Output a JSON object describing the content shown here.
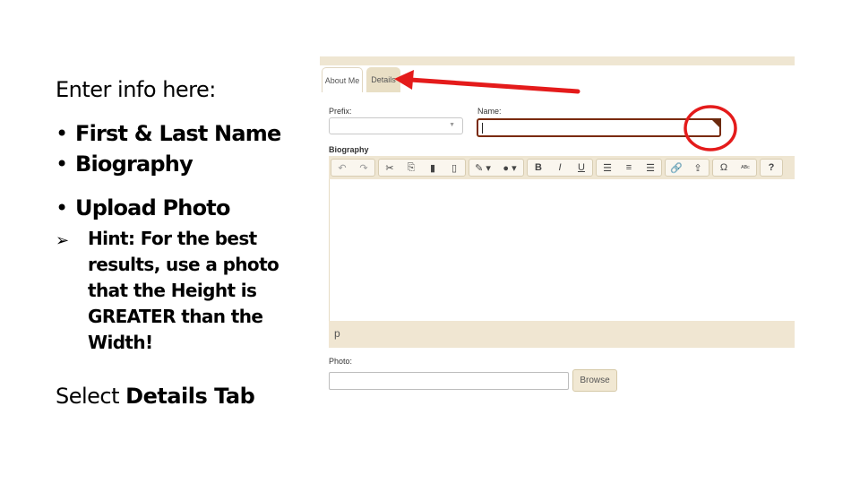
{
  "instructions": {
    "intro": "Enter info here:",
    "bullets": [
      "First & Last Name",
      "Biography"
    ],
    "upload": "Upload Photo",
    "hint": "Hint: For the best results, use a photo that the Height is GREATER than the Width!",
    "select_prefix": "Select ",
    "select_bold": "Details Tab",
    "bullet_glyph": "•",
    "hint_glyph": "➢"
  },
  "form": {
    "tabs": [
      {
        "label": "About Me",
        "active": true
      },
      {
        "label": "Details",
        "active": false
      }
    ],
    "prefix": {
      "label": "Prefix:",
      "value": ""
    },
    "name": {
      "label": "Name:",
      "value": ""
    },
    "biography": {
      "label": "Biography",
      "status_path": "p"
    },
    "toolbar": [
      [
        "undo-icon",
        "redo-icon"
      ],
      [
        "cut-icon",
        "copy-icon",
        "paste-icon",
        "paste-text-icon"
      ],
      [
        "text-color-icon",
        "background-color-icon"
      ],
      [
        "bold-icon",
        "italic-icon",
        "underline-icon"
      ],
      [
        "align-left-icon",
        "align-center-icon",
        "align-right-icon"
      ],
      [
        "link-icon",
        "upload-icon"
      ],
      [
        "special-character-icon",
        "spellcheck-icon"
      ],
      [
        "help-icon"
      ]
    ],
    "toolbar_glyphs": {
      "undo": "↶",
      "redo": "↷",
      "cut": "✂",
      "copy": "⎘",
      "paste": "▮",
      "paste_text": "▯",
      "text_color": "✎ ▾",
      "bg_color": "● ▾",
      "bold": "B",
      "italic": "I",
      "underline": "U",
      "align_left": "☰",
      "align_center": "≡",
      "align_right": "☰",
      "link": "🔗",
      "upload": "⇪",
      "omega": "Ω",
      "spell": "ᴬᴮᶜ",
      "help": "?"
    },
    "photo": {
      "label": "Photo:",
      "value": "",
      "browse_label": "Browse"
    }
  },
  "colors": {
    "accent_red": "#e41b1b",
    "name_border": "#7a2a0c",
    "panel_beige": "#efe6d2"
  }
}
